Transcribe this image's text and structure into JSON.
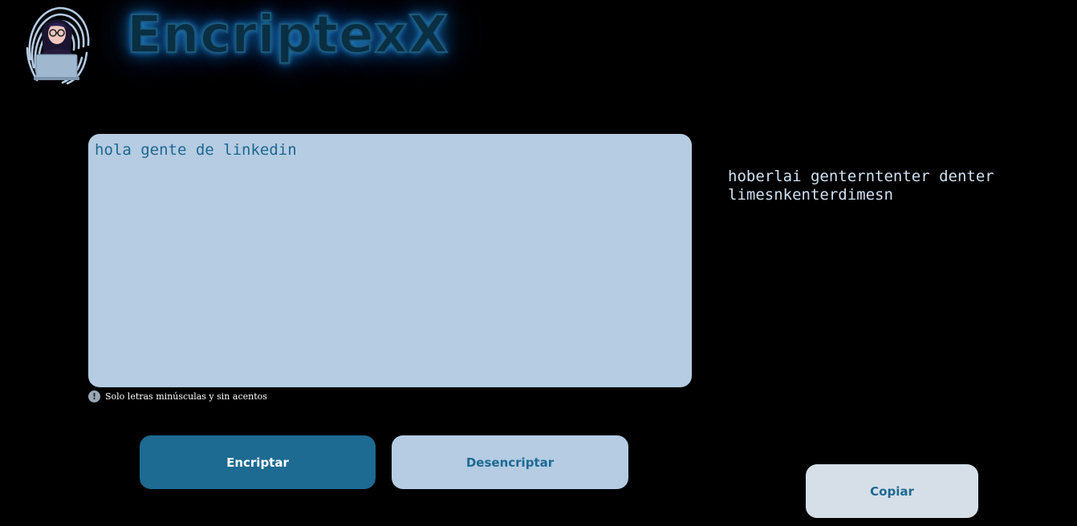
{
  "header": {
    "brand": "EncriptexX"
  },
  "input": {
    "value": "hola gente de linkedin"
  },
  "hint": {
    "icon": "!",
    "text": "Solo letras minúsculas y sin acentos"
  },
  "actions": {
    "encrypt_label": "Encriptar",
    "decrypt_label": "Desencriptar",
    "copy_label": "Copiar"
  },
  "output": {
    "text": "hoberlai genterntenter denter\nlimesnkenterdimesn"
  },
  "colors": {
    "background": "#000000",
    "accent": "#1d6a92",
    "light_panel": "#b5cce3",
    "copy_button": "#d6dfe8",
    "glow": "#2a96e6"
  }
}
